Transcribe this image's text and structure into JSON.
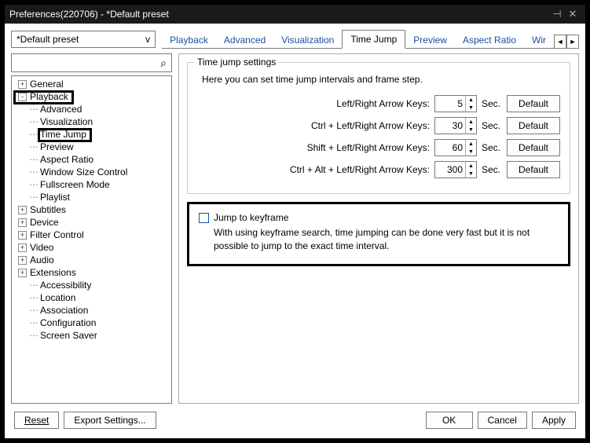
{
  "title": "Preferences(220706) - *Default preset",
  "preset": "*Default preset",
  "preset_caret": "v",
  "tabs": [
    "Playback",
    "Advanced",
    "Visualization",
    "Time Jump",
    "Preview",
    "Aspect Ratio",
    "Wir"
  ],
  "active_tab": 3,
  "tabnav": {
    "left": "◄",
    "right": "►"
  },
  "tree": [
    {
      "d": 0,
      "exp": "+",
      "label": "General"
    },
    {
      "d": 0,
      "exp": "-",
      "label": "Playback",
      "hl": true
    },
    {
      "d": 1,
      "label": "Advanced"
    },
    {
      "d": 1,
      "label": "Visualization"
    },
    {
      "d": 1,
      "label": "Time Jump",
      "hl": true
    },
    {
      "d": 1,
      "label": "Preview"
    },
    {
      "d": 1,
      "label": "Aspect Ratio"
    },
    {
      "d": 1,
      "label": "Window Size Control"
    },
    {
      "d": 1,
      "label": "Fullscreen Mode"
    },
    {
      "d": 1,
      "label": "Playlist"
    },
    {
      "d": 0,
      "exp": "+",
      "label": "Subtitles"
    },
    {
      "d": 0,
      "exp": "+",
      "label": "Device"
    },
    {
      "d": 0,
      "exp": "+",
      "label": "Filter Control"
    },
    {
      "d": 0,
      "exp": "+",
      "label": "Video"
    },
    {
      "d": 0,
      "exp": "+",
      "label": "Audio"
    },
    {
      "d": 0,
      "exp": "+",
      "label": "Extensions"
    },
    {
      "d": 1,
      "label": "Accessibility",
      "parentless": true
    },
    {
      "d": 1,
      "label": "Location",
      "parentless": true
    },
    {
      "d": 1,
      "label": "Association",
      "parentless": true
    },
    {
      "d": 1,
      "label": "Configuration",
      "parentless": true
    },
    {
      "d": 1,
      "label": "Screen Saver",
      "parentless": true
    }
  ],
  "group": {
    "legend": "Time jump settings",
    "desc": "Here you can set time jump intervals and frame step.",
    "rows": [
      {
        "label": "Left/Right Arrow Keys:",
        "value": "5",
        "unit": "Sec.",
        "btn": "Default"
      },
      {
        "label": "Ctrl + Left/Right Arrow Keys:",
        "value": "30",
        "unit": "Sec.",
        "btn": "Default"
      },
      {
        "label": "Shift + Left/Right Arrow Keys:",
        "value": "60",
        "unit": "Sec.",
        "btn": "Default"
      },
      {
        "label": "Ctrl + Alt + Left/Right Arrow Keys:",
        "value": "300",
        "unit": "Sec.",
        "btn": "Default"
      }
    ]
  },
  "keyframe": {
    "label": "Jump to keyframe",
    "desc": "With using keyframe search, time jumping can be done very fast but it is not possible to jump to the exact time interval."
  },
  "footer": {
    "reset": "Reset",
    "export": "Export Settings...",
    "ok": "OK",
    "cancel": "Cancel",
    "apply": "Apply"
  },
  "icons": {
    "pin": "⊣",
    "close": "✕"
  }
}
